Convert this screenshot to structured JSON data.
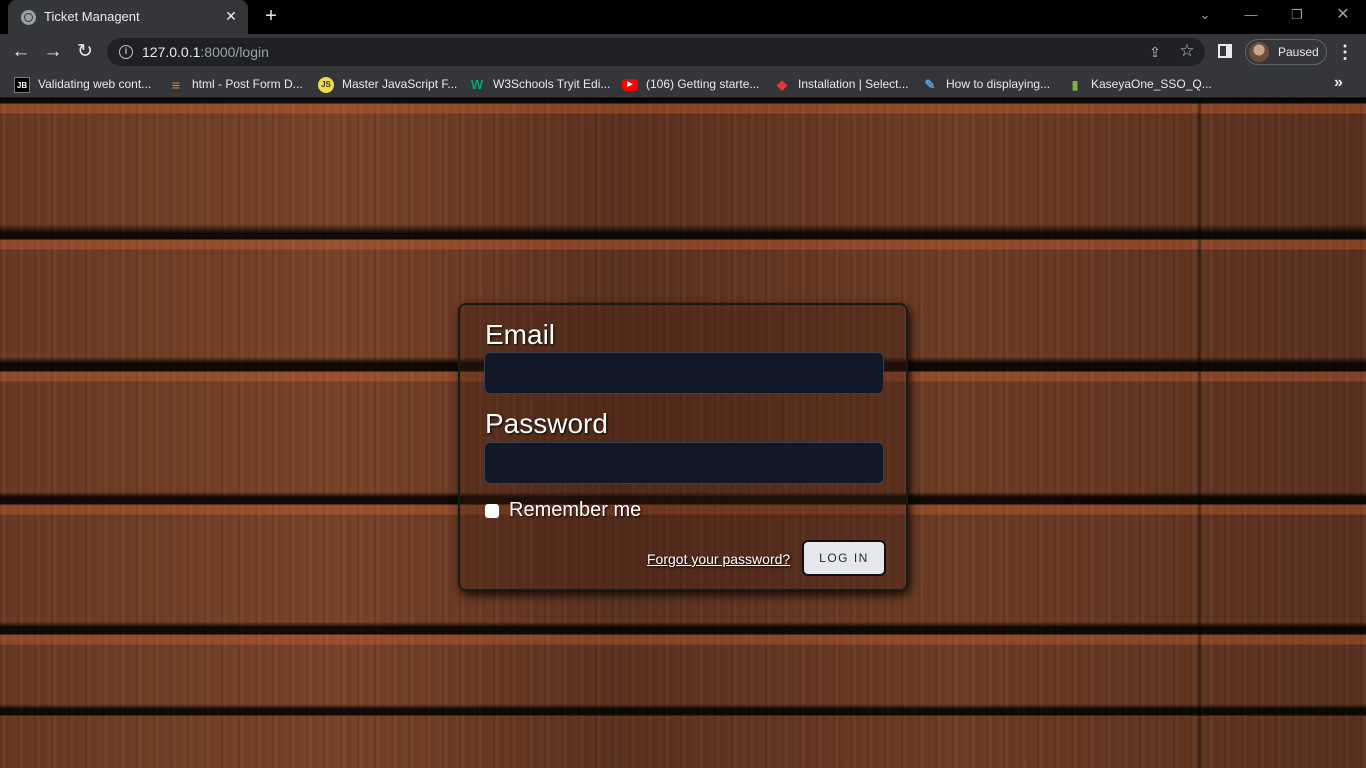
{
  "browser": {
    "tab": {
      "title": "Ticket Managent",
      "close_glyph": "✕",
      "favicon": "globe-icon"
    },
    "new_tab_glyph": "+",
    "window_controls": {
      "chevron": "⌄",
      "minimize": "—",
      "maximize": "❐",
      "close": "✕"
    },
    "nav": {
      "back": "←",
      "forward": "→",
      "reload": "↻"
    },
    "address": {
      "host": "127.0.0.1",
      "path": ":8000/login",
      "info_glyph": "i"
    },
    "share_glyph": "⇪",
    "star_glyph": "☆",
    "profile": {
      "label": "Paused"
    },
    "menu_glyph": "⋮",
    "bookmarks_more": "»",
    "bookmarks": [
      {
        "label": "Validating web cont...",
        "icon": "jb-icon",
        "glyph": "JB",
        "bg": "#000000",
        "fg": "#ffffff"
      },
      {
        "label": "html - Post Form D...",
        "icon": "stackoverflow-icon",
        "glyph": "≡",
        "bg": "#35363a",
        "fg": "#f48024"
      },
      {
        "label": "Master JavaScript F...",
        "icon": "js-icon",
        "glyph": "JS",
        "bg": "#f0db4f",
        "fg": "#323330"
      },
      {
        "label": "W3Schools Tryit Edi...",
        "icon": "w3schools-icon",
        "glyph": "W",
        "bg": "#35363a",
        "fg": "#04aa6d"
      },
      {
        "label": "(106) Getting starte...",
        "icon": "youtube-icon",
        "glyph": "▶",
        "bg": "#ff0000",
        "fg": "#ffffff"
      },
      {
        "label": "Installation | Select...",
        "icon": "layers-icon",
        "glyph": "◆",
        "bg": "#35363a",
        "fg": "#e53935"
      },
      {
        "label": "How to displaying...",
        "icon": "feather-icon",
        "glyph": "✎",
        "bg": "#35363a",
        "fg": "#5aa0e0"
      },
      {
        "label": "KaseyaOne_SSO_Q...",
        "icon": "kaseya-icon",
        "glyph": "▮",
        "bg": "#35363a",
        "fg": "#7cb342"
      }
    ]
  },
  "login": {
    "email_label": "Email",
    "email_value": "",
    "password_label": "Password",
    "password_value": "",
    "remember_label": "Remember me",
    "remember_checked": false,
    "forgot_label": "Forgot your password?",
    "submit_label": "LOG IN"
  },
  "colors": {
    "input_bg": "#111827",
    "button_bg": "#e5e7eb",
    "chrome_bg": "#35363a",
    "omnibox_bg": "#202124"
  }
}
